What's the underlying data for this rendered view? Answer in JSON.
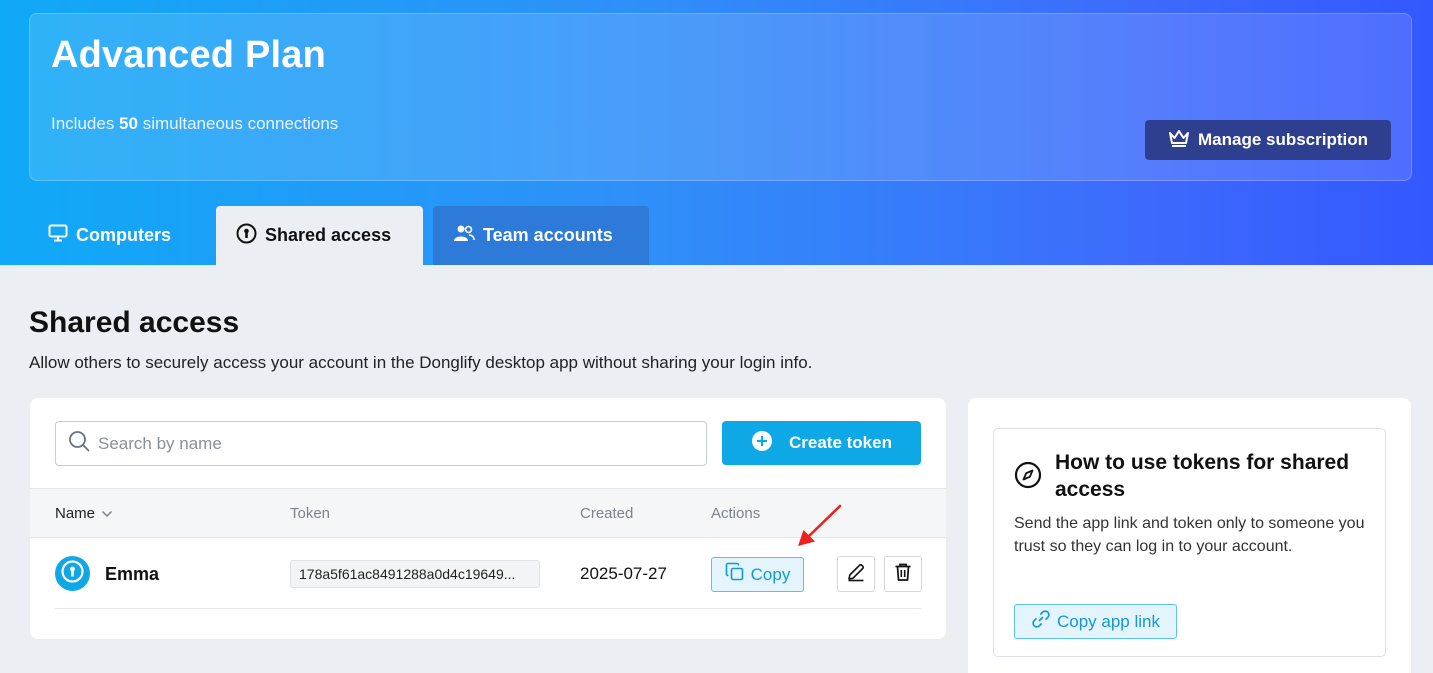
{
  "plan": {
    "title": "Advanced Plan",
    "includes_prefix": "Includes ",
    "connections": "50",
    "includes_suffix": " simultaneous connections",
    "manage_label": "Manage subscription"
  },
  "tabs": [
    {
      "label": "Computers",
      "icon": "monitor-icon",
      "active": false
    },
    {
      "label": "Shared access",
      "icon": "keyhole-icon",
      "active": true
    },
    {
      "label": "Team accounts",
      "icon": "users-icon",
      "active": false
    }
  ],
  "page": {
    "title": "Shared access",
    "description": "Allow others to securely access your account in the Donglify desktop app without sharing your login info."
  },
  "search": {
    "placeholder": "Search by name",
    "value": ""
  },
  "create_token_label": "Create token",
  "table": {
    "headers": {
      "name": "Name",
      "token": "Token",
      "created": "Created",
      "actions": "Actions"
    },
    "rows": [
      {
        "name": "Emma",
        "token": "178a5f61ac8491288a0d4c19649...",
        "created": "2025-07-27",
        "copy_label": "Copy"
      }
    ]
  },
  "info": {
    "title": "How to use tokens for shared access",
    "description": "Send the app link and token only to someone you trust so they can log in to your account.",
    "copy_app_link_label": "Copy app link"
  },
  "colors": {
    "accent": "#0fa8e6",
    "manage_button": "#2f3f8f",
    "annotation_arrow": "#e8231b"
  }
}
